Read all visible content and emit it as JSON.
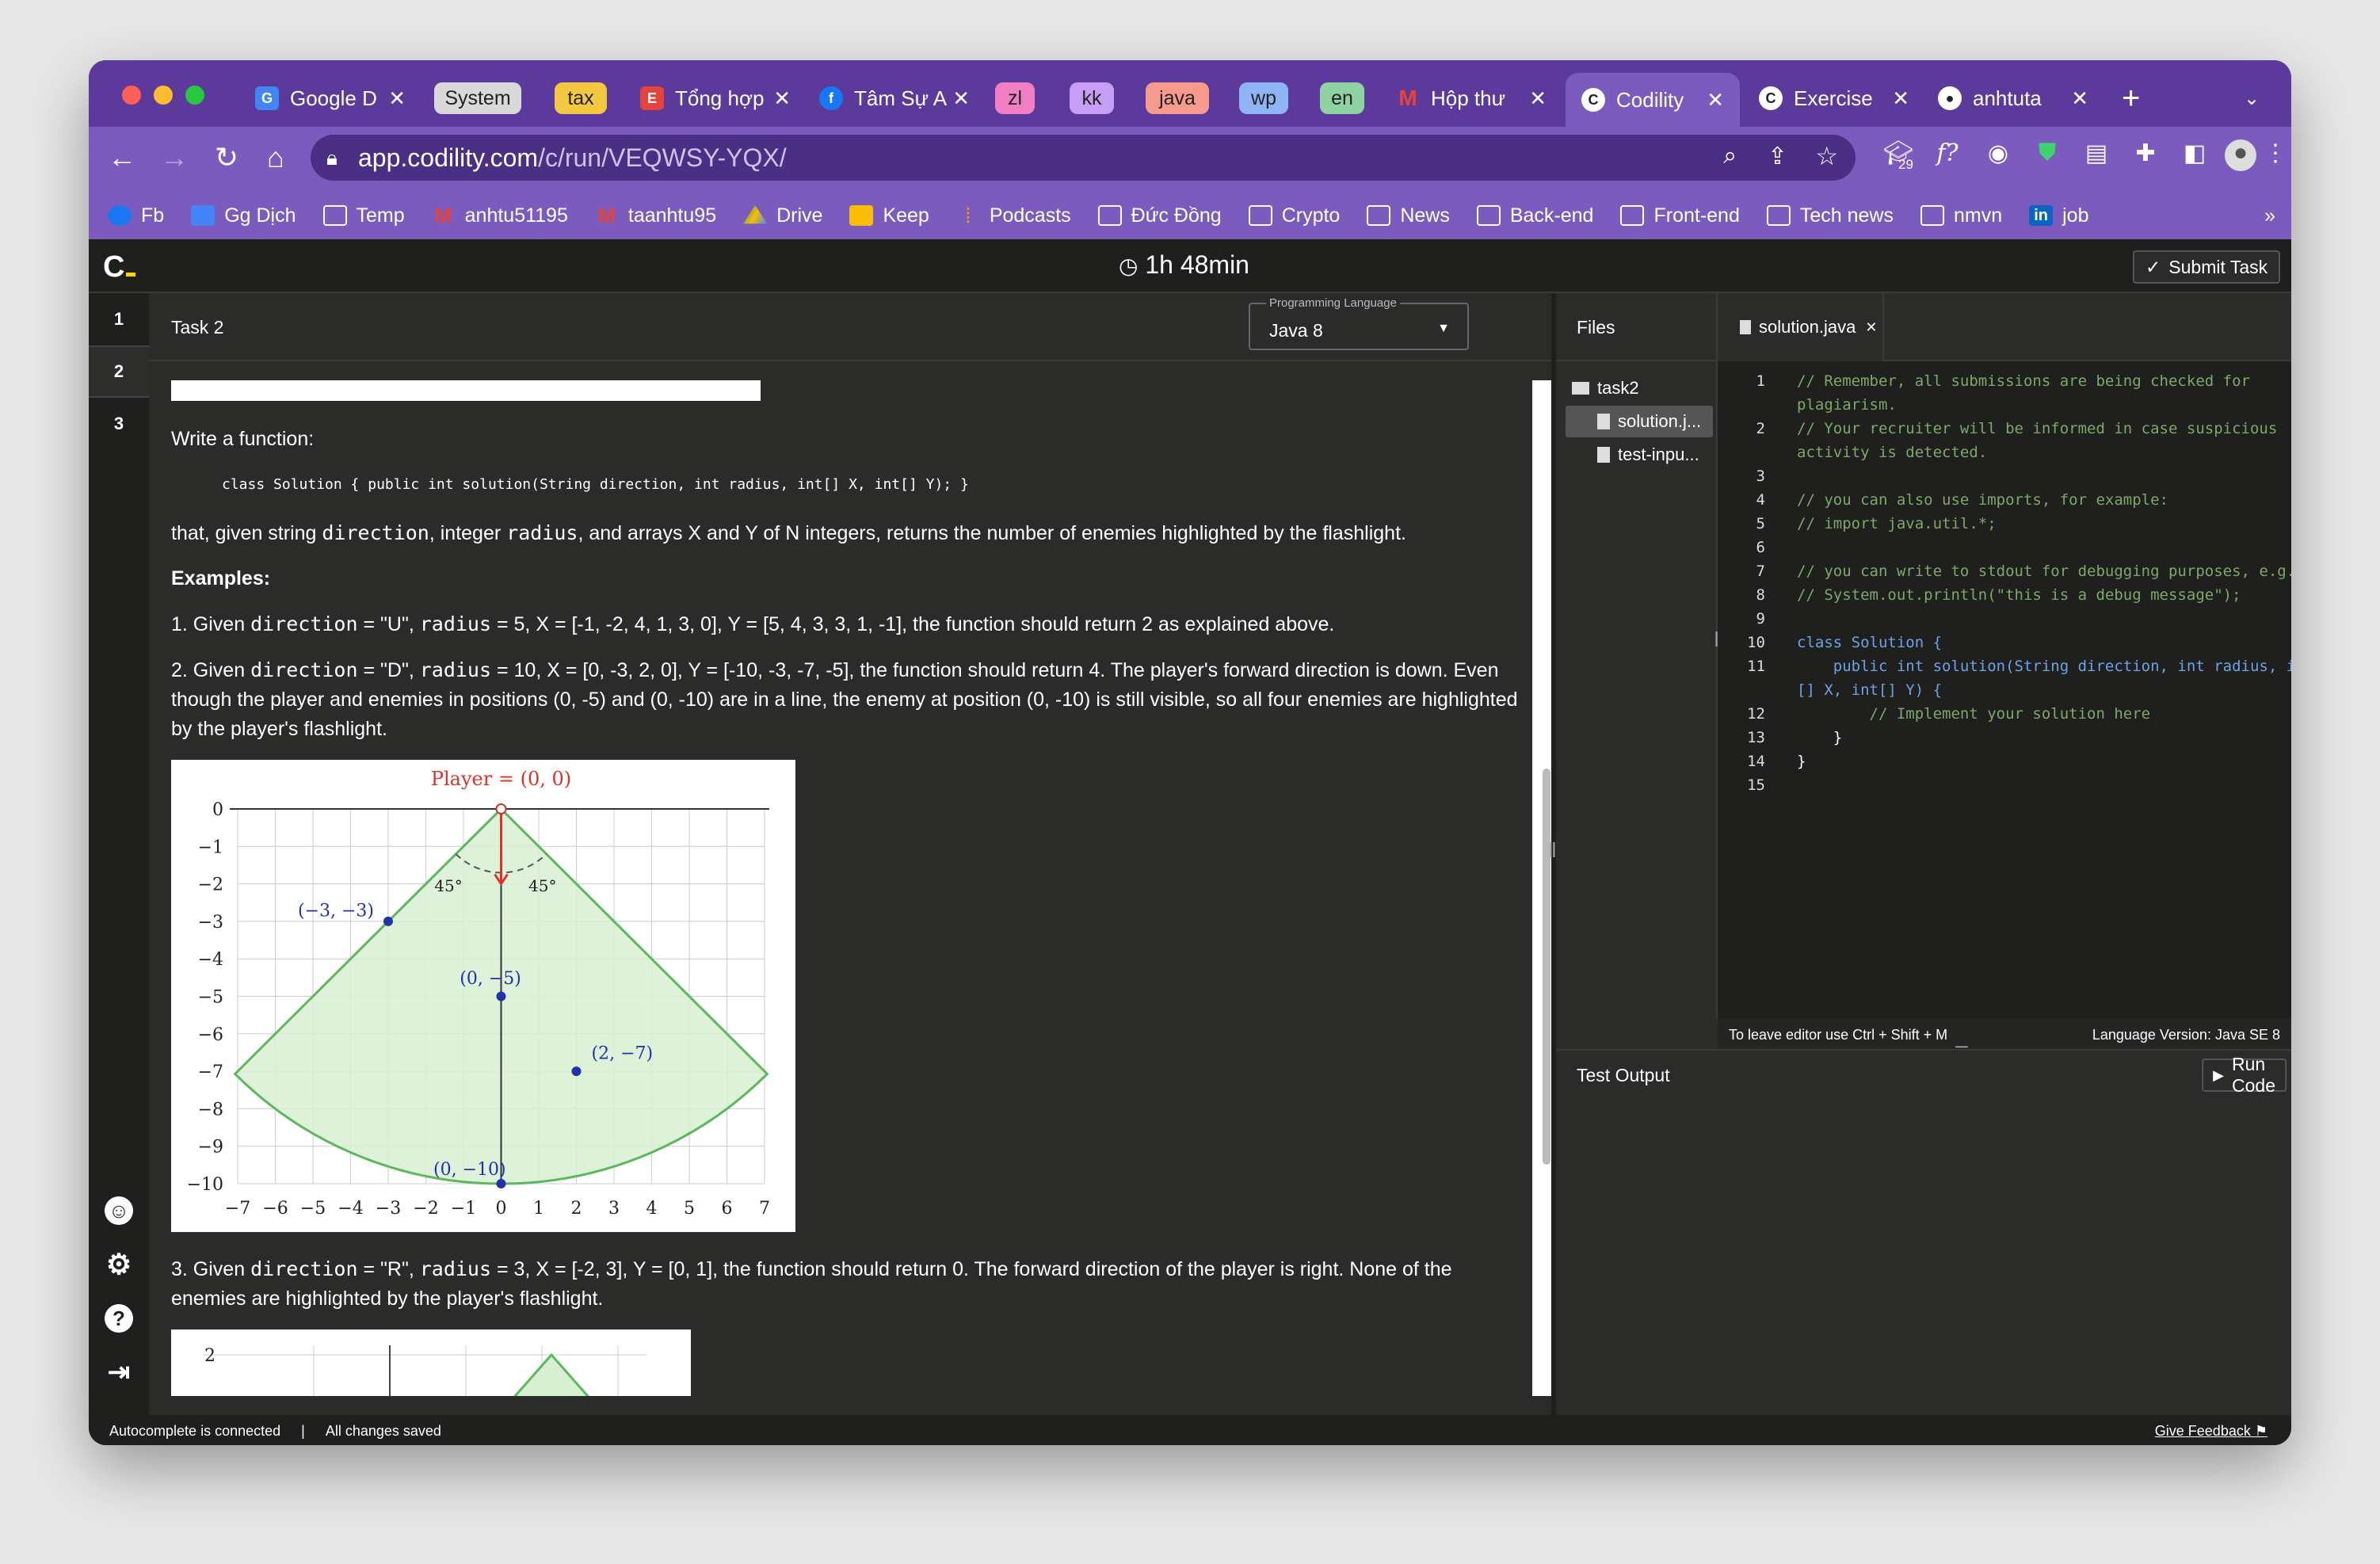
{
  "browser": {
    "tabs": [
      {
        "label": "Google D",
        "kind": "tab"
      },
      {
        "label": "System",
        "kind": "group",
        "color": "#d9d9d9"
      },
      {
        "label": "tax",
        "kind": "group",
        "color": "#f5c842"
      },
      {
        "label": "Tổng hợp",
        "kind": "tab"
      },
      {
        "label": "Tâm Sự A",
        "kind": "tab"
      },
      {
        "label": "zl",
        "kind": "group",
        "color": "#f07fc4"
      },
      {
        "label": "kk",
        "kind": "group",
        "color": "#c79ef5"
      },
      {
        "label": "java",
        "kind": "group",
        "color": "#f59a8c"
      },
      {
        "label": "wp",
        "kind": "group",
        "color": "#8fb4f5"
      },
      {
        "label": "en",
        "kind": "group",
        "color": "#8fd3a3"
      },
      {
        "label": "Hộp thư",
        "kind": "tab"
      },
      {
        "label": "Codility",
        "kind": "tab",
        "active": true
      },
      {
        "label": "Exercise",
        "kind": "tab"
      },
      {
        "label": "anhtuta",
        "kind": "tab"
      }
    ],
    "url_host": "app.codility.com",
    "url_path": "/c/run/VEQWSY-YQX/",
    "extension_badge": "29",
    "bookmarks": [
      "Fb",
      "Gg Dịch",
      "Temp",
      "anhtu51195",
      "taanhtu95",
      "Drive",
      "Keep",
      "Podcasts",
      "Đức Đồng",
      "Crypto",
      "News",
      "Back-end",
      "Front-end",
      "Tech news",
      "nmvn",
      "job"
    ]
  },
  "app": {
    "logo": "C",
    "timer": "1h 48min",
    "submit_label": "Submit Task",
    "task_numbers": [
      "1",
      "2",
      "3"
    ],
    "task_title": "Task 2",
    "language_label": "Programming Language",
    "language_value": "Java 8",
    "files_label": "Files",
    "file_tree": {
      "folder": "task2",
      "files": [
        "solution.j...",
        "test-inpu..."
      ]
    },
    "editor_tab": "solution.java",
    "editor_hint": "To leave editor use Ctrl + Shift + M",
    "language_version": "Language Version: Java SE 8",
    "test_output_label": "Test Output",
    "run_label": "Run Code",
    "status_left": "Autocomplete is connected",
    "status_sep": "|",
    "status_saved": "All changes saved",
    "feedback": "Give Feedback"
  },
  "task": {
    "write_fn": "Write a function:",
    "signature": "class Solution { public int solution(String direction, int radius, int[] X, int[] Y); }",
    "desc_pre": "that, given string ",
    "desc_dir": "direction",
    "desc_mid": ", integer ",
    "desc_rad": "radius",
    "desc_post": ", and arrays X and Y of N integers, returns the number of enemies highlighted by the flashlight.",
    "examples_heading": "Examples:",
    "ex1_a": "1. Given ",
    "ex1_b": " = \"U\", ",
    "ex1_c": " = 5, X = [-1, -2, 4, 1, 3, 0], Y = [5, 4, 3, 3, 1, -1], the function should return 2 as explained above.",
    "ex2_a": "2. Given ",
    "ex2_b": " = \"D\", ",
    "ex2_c": " = 10, X = [0, -3, 2, 0], Y = [-10, -3, -7, -5], the function should return 4. The player's forward direction is down. Even though the player and enemies in positions (0, -5) and (0, -10) are in a line, the enemy at position (0, -10) is still visible, so all four enemies are highlighted by the player's flashlight.",
    "ex3_a": "3. Given ",
    "ex3_b": " = \"R\", ",
    "ex3_c": " = 3, X = [-2, 3], Y = [0, 1], the function should return 0. The forward direction of the player is right. None of the enemies are highlighted by the player's flashlight.",
    "word_direction": "direction",
    "word_radius": "radius"
  },
  "figure": {
    "title": "Player = (0, 0)",
    "angle_label": "45°",
    "x_ticks": [
      -7,
      -6,
      -5,
      -4,
      -3,
      -2,
      -1,
      0,
      1,
      2,
      3,
      4,
      5,
      6,
      7
    ],
    "y_ticks": [
      0,
      -1,
      -2,
      -3,
      -4,
      -5,
      -6,
      -7,
      -8,
      -9,
      -10
    ],
    "points": [
      {
        "x": -3,
        "y": -3,
        "label": "(−3, −3)"
      },
      {
        "x": 0,
        "y": -5,
        "label": "(0, −5)"
      },
      {
        "x": 2,
        "y": -7,
        "label": "(2, −7)"
      },
      {
        "x": 0,
        "y": -10,
        "label": "(0, −10)"
      }
    ],
    "fig2_tick": "2",
    "colors": {
      "cone": "#5cb85c",
      "fill": "#d8efd2",
      "point": "#2233aa",
      "title": "#e0302a",
      "arrow": "#e0302a"
    }
  },
  "code": [
    {
      "n": "1",
      "t": "// Remember, all submissions are being checked for",
      "c": "cm"
    },
    {
      "n": "",
      "t": "plagiarism.",
      "c": "cm"
    },
    {
      "n": "2",
      "t": "// Your recruiter will be informed in case suspicious",
      "c": "cm"
    },
    {
      "n": "",
      "t": "activity is detected.",
      "c": "cm"
    },
    {
      "n": "3",
      "t": "",
      "c": ""
    },
    {
      "n": "4",
      "t": "// you can also use imports, for example:",
      "c": "cm"
    },
    {
      "n": "5",
      "t": "// import java.util.*;",
      "c": "cm"
    },
    {
      "n": "6",
      "t": "",
      "c": ""
    },
    {
      "n": "7",
      "t": "// you can write to stdout for debugging purposes, e.g.",
      "c": "cm"
    },
    {
      "n": "8",
      "t": "// System.out.println(\"this is a debug message\");",
      "c": "cm"
    },
    {
      "n": "9",
      "t": "",
      "c": ""
    },
    {
      "n": "10",
      "t": "class Solution {",
      "c": "kw"
    },
    {
      "n": "11",
      "t": "    public int solution(String direction, int radius, int",
      "c": "kw"
    },
    {
      "n": "",
      "t": "[] X, int[] Y) {",
      "c": "kw"
    },
    {
      "n": "12",
      "t": "        // Implement your solution here",
      "c": "cm"
    },
    {
      "n": "13",
      "t": "    }",
      "c": ""
    },
    {
      "n": "14",
      "t": "}",
      "c": ""
    },
    {
      "n": "15",
      "t": "",
      "c": ""
    }
  ]
}
